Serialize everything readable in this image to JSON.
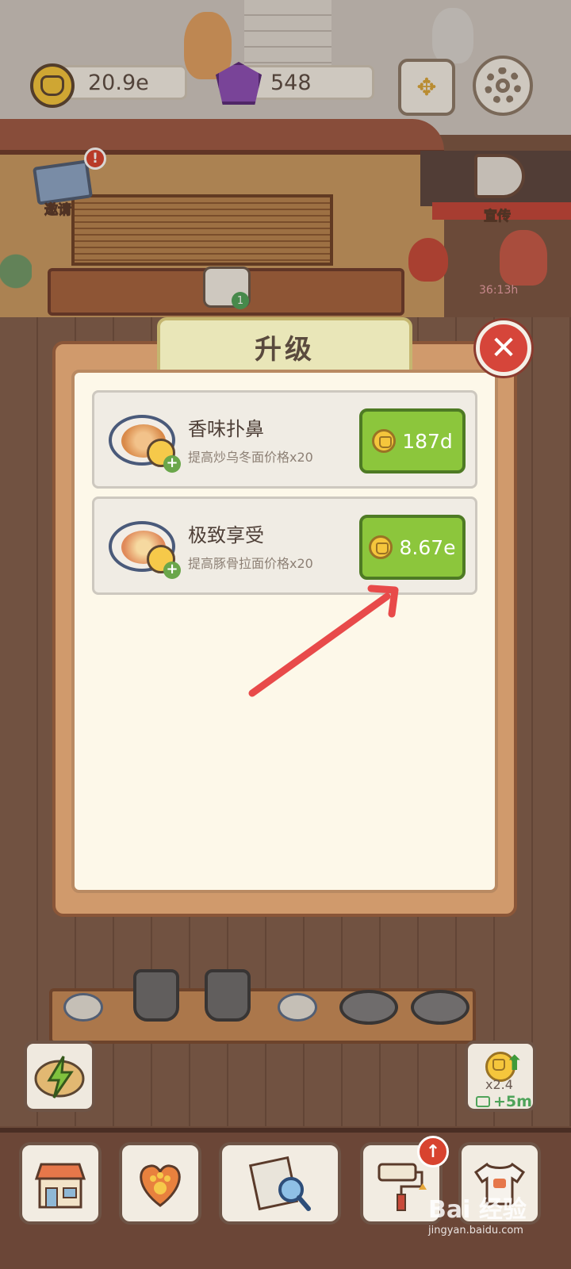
{
  "hud": {
    "coins": "20.9e",
    "gems": "548"
  },
  "scene": {
    "invite_label": "邀请",
    "invite_alert": "!",
    "promote_label": "宣传",
    "order_count": "1",
    "timer_text": "36:13h"
  },
  "dialog": {
    "title": "升级",
    "items": [
      {
        "name": "香味扑鼻",
        "description": "提高炒乌冬面价格x20",
        "price": "187d",
        "dish_color": "#d98a4a"
      },
      {
        "name": "极致享受",
        "description": "提高豚骨拉面价格x20",
        "price": "8.67e",
        "dish_color": "#e08a5a"
      }
    ]
  },
  "bottom": {
    "boost_multiplier": "x2.4",
    "boost_time": "+5m",
    "upgrade_alert": "↑"
  },
  "watermark": {
    "brand": "Bai 经验",
    "url": "jingyan.baidu.com"
  },
  "colors": {
    "buy_button": "#8cc63c",
    "close_button": "#d6453a",
    "annotation_arrow": "#e84a4a",
    "dialog_tab": "#e9e6b8"
  }
}
